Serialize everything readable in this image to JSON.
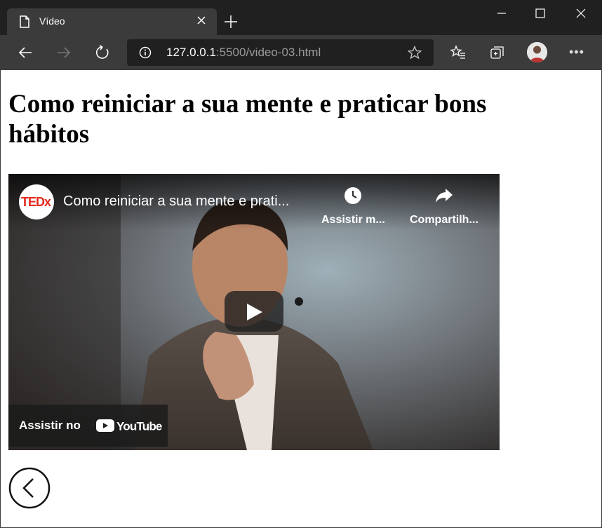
{
  "tab": {
    "title": "Vídeo"
  },
  "address_bar": {
    "host": "127.0.0.1",
    "port_path": ":5500/video-03.html"
  },
  "page": {
    "heading": "Como reiniciar a sua mente e praticar bons hábitos"
  },
  "video": {
    "channel_logo": "TEDx",
    "title": "Como reiniciar a sua mente e prati...",
    "watch_later_label": "Assistir m...",
    "share_label": "Compartilh...",
    "watch_on_label": "Assistir no",
    "youtube_logo_text": "YouTube"
  },
  "icons": {
    "tab_doc": "document-icon",
    "back": "back-arrow-icon",
    "forward": "forward-arrow-icon",
    "refresh": "refresh-icon",
    "info": "info-icon",
    "favorite": "star-icon",
    "favorites": "favorites-icon",
    "collections": "collections-icon",
    "more": "more-icon",
    "page_back": "chevron-left-icon"
  }
}
